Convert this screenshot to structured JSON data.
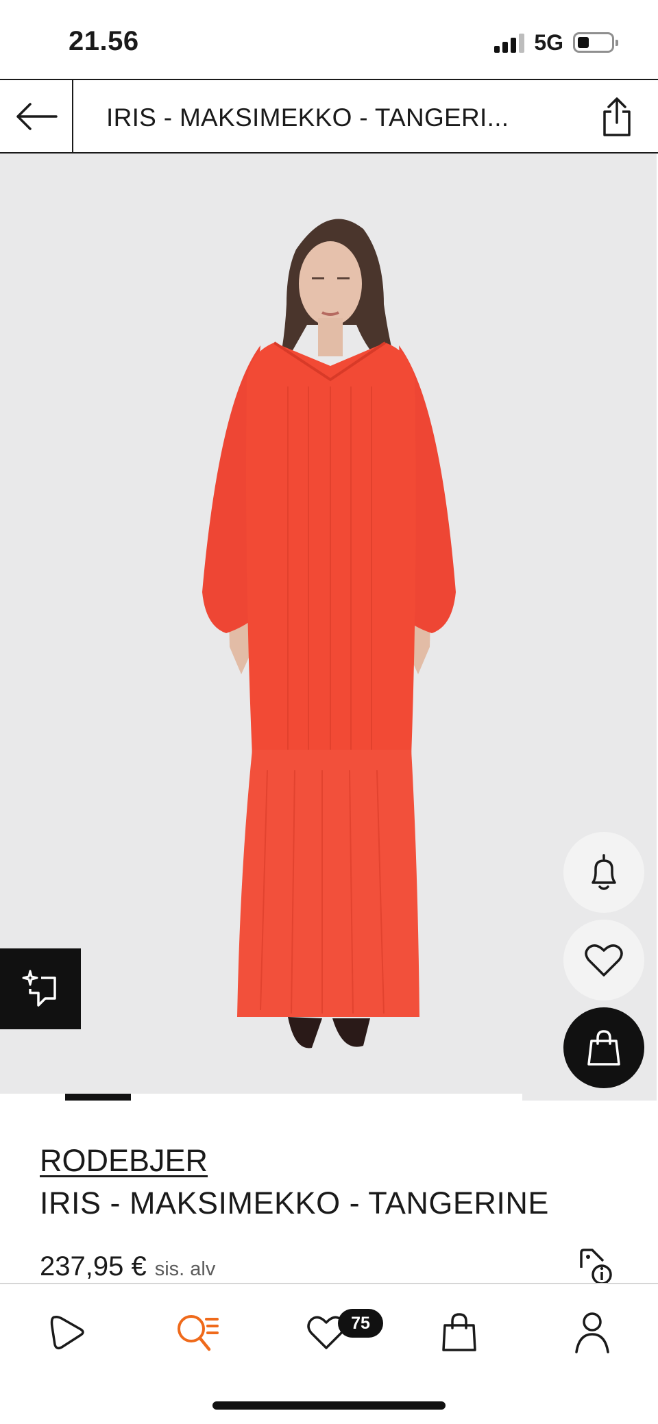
{
  "status_bar": {
    "time": "21.56",
    "network": "5G"
  },
  "header": {
    "title": "IRIS - MAKSIMEKKO - TANGERI...",
    "back_icon": "arrow-left-icon",
    "share_icon": "share-icon"
  },
  "product_image": {
    "dress_color": "#f24a35",
    "background": "#e9e9ea",
    "carousel_active_index": 1
  },
  "actions": {
    "notify_icon": "bell-icon",
    "wishlist_icon": "heart-icon",
    "bag_icon": "shopping-bag-icon",
    "compare_icon": "sparkle-compare-icon"
  },
  "product": {
    "brand": "RODEBJER",
    "name": "IRIS - MAKSIMEKKO - TANGERINE",
    "price": "237,95 €",
    "vat_note": "sis. alv"
  },
  "bottom_nav": {
    "items": [
      {
        "name": "home",
        "icon": "play-shape-icon"
      },
      {
        "name": "search",
        "icon": "search-list-icon",
        "active_color": "#ef6a1b"
      },
      {
        "name": "wishlist",
        "icon": "heart-icon"
      },
      {
        "name": "cart",
        "icon": "shopping-bag-icon"
      },
      {
        "name": "account",
        "icon": "person-icon"
      }
    ],
    "wishlist_count": "75"
  }
}
